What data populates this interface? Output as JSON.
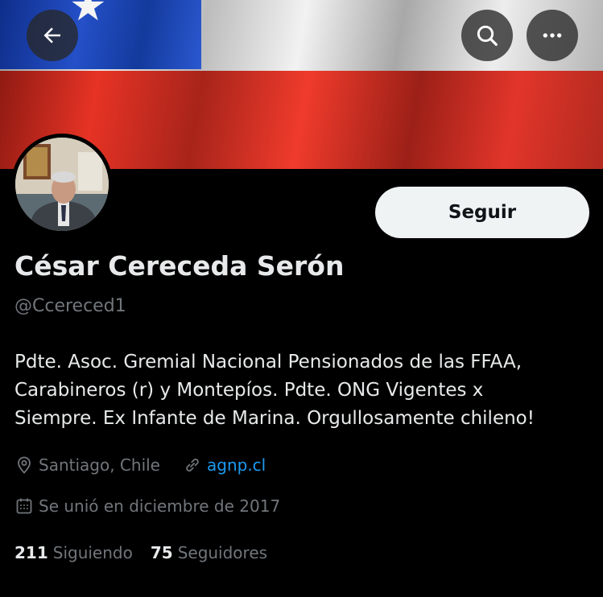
{
  "header": {
    "back_icon": "arrow-left-icon",
    "search_icon": "search-icon",
    "more_icon": "more-horizontal-icon"
  },
  "profile": {
    "name": "César Cereceda Serón",
    "handle": "@Ccereced1",
    "follow_label": "Seguir",
    "bio_lines": [
      "Pdte. Asoc. Gremial Nacional Pensionados de las FFAA,",
      "Carabineros (r) y Montepíos. Pdte. ONG Vigentes x",
      "Siempre. Ex Infante de Marina. Orgullosamente chileno!"
    ],
    "location": "Santiago, Chile",
    "website": "agnp.cl",
    "joined": "Se unió en diciembre de 2017",
    "following_count": "211",
    "following_label": "Siguiendo",
    "followers_count": "75",
    "followers_label": "Seguidores"
  },
  "colors": {
    "accent_link": "#1d9bf0",
    "muted_text": "#71767b",
    "background": "#000000"
  }
}
